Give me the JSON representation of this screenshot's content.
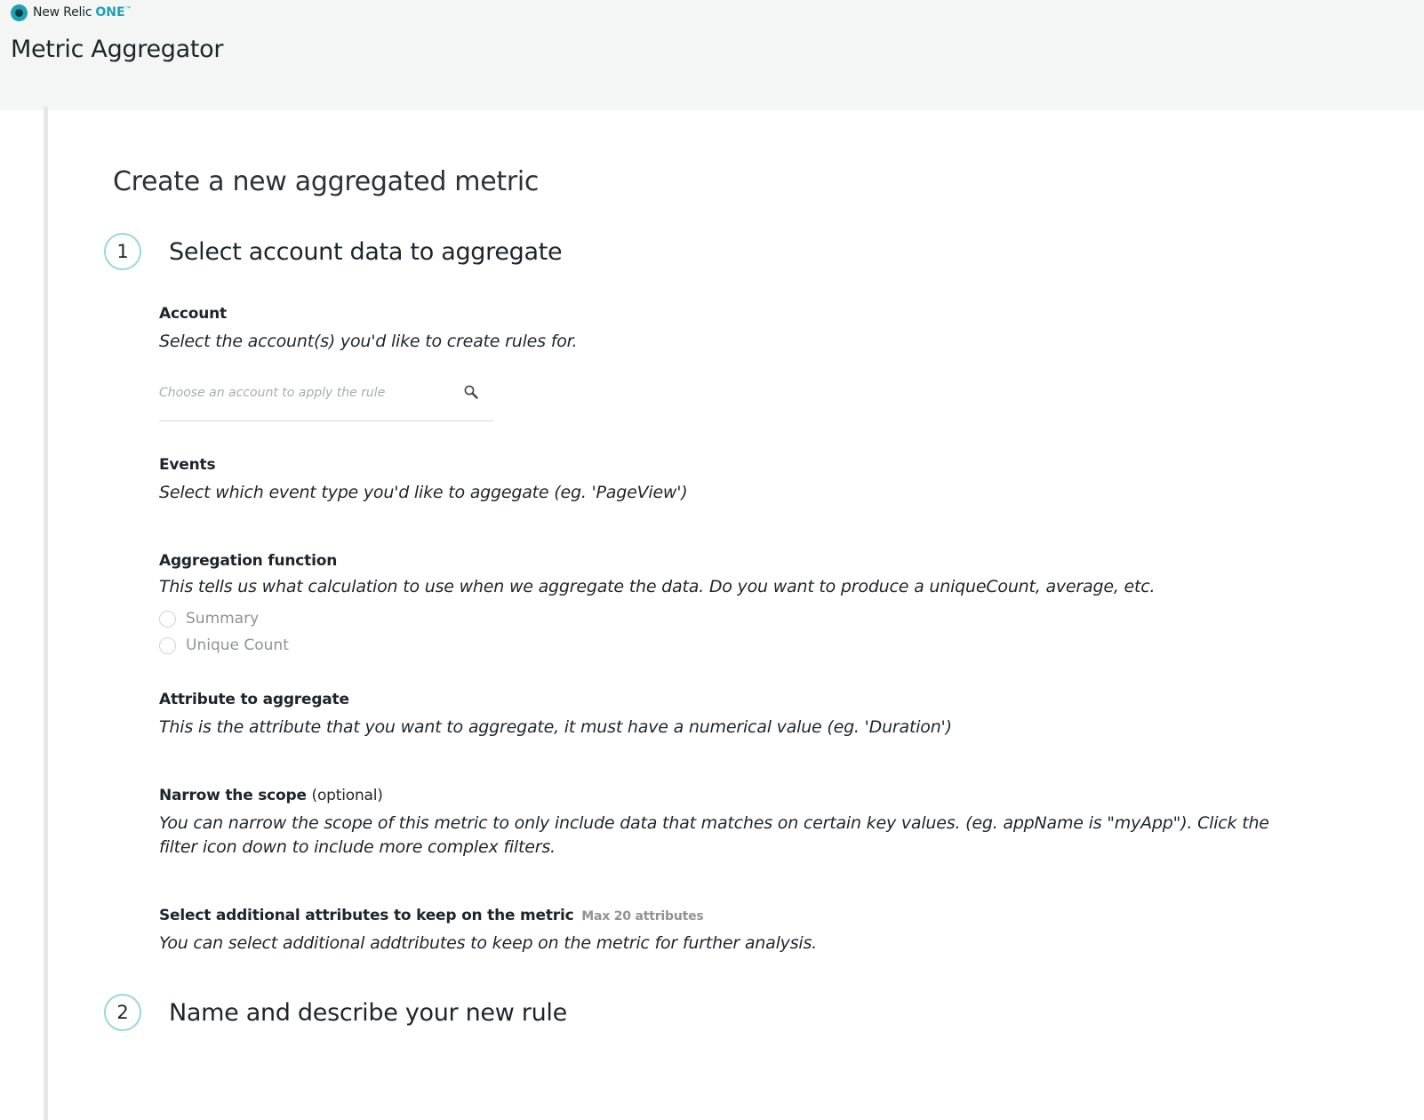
{
  "header": {
    "brand_name": "New Relic",
    "brand_one": "ONE",
    "brand_tm": "™",
    "app_title": "Metric Aggregator"
  },
  "page": {
    "heading": "Create a new aggregated metric"
  },
  "steps": [
    {
      "number": "1",
      "title": "Select account data to aggregate"
    },
    {
      "number": "2",
      "title": "Name and describe your new rule"
    }
  ],
  "account": {
    "label": "Account",
    "description": "Select the account(s) you'd like to create rules for.",
    "placeholder": "Choose an account to apply the rule",
    "value": ""
  },
  "events": {
    "label": "Events",
    "description": "Select which event type you'd like to aggegate (eg. 'PageView')"
  },
  "aggregation": {
    "label": "Aggregation function",
    "description": "This tells us what calculation to use when we aggregate the data. Do you want to produce a uniqueCount, average, etc.",
    "options": [
      "Summary",
      "Unique Count"
    ]
  },
  "attribute": {
    "label": "Attribute to aggregate",
    "description": "This is the attribute that you want to aggregate, it must have a numerical value (eg. 'Duration')"
  },
  "scope": {
    "label": "Narrow the scope",
    "label_suffix": "(optional)",
    "description": "You can narrow the scope of this metric to only include data that matches on certain key values. (eg. appName is \"myApp\"). Click the filter icon down to include more complex filters."
  },
  "additional": {
    "label": "Select additional attributes to keep on the metric",
    "hint": "Max 20 attributes",
    "description": "You can select additional addtributes to keep on the metric for further analysis."
  },
  "colors": {
    "accent": "#1ca3b3",
    "step_ring": "#9dd5dd",
    "topbar_bg": "#f4f5f5"
  },
  "icons": {
    "brand": "new-relic-logo-icon",
    "search": "search-icon",
    "radio": "radio-unchecked-icon"
  }
}
